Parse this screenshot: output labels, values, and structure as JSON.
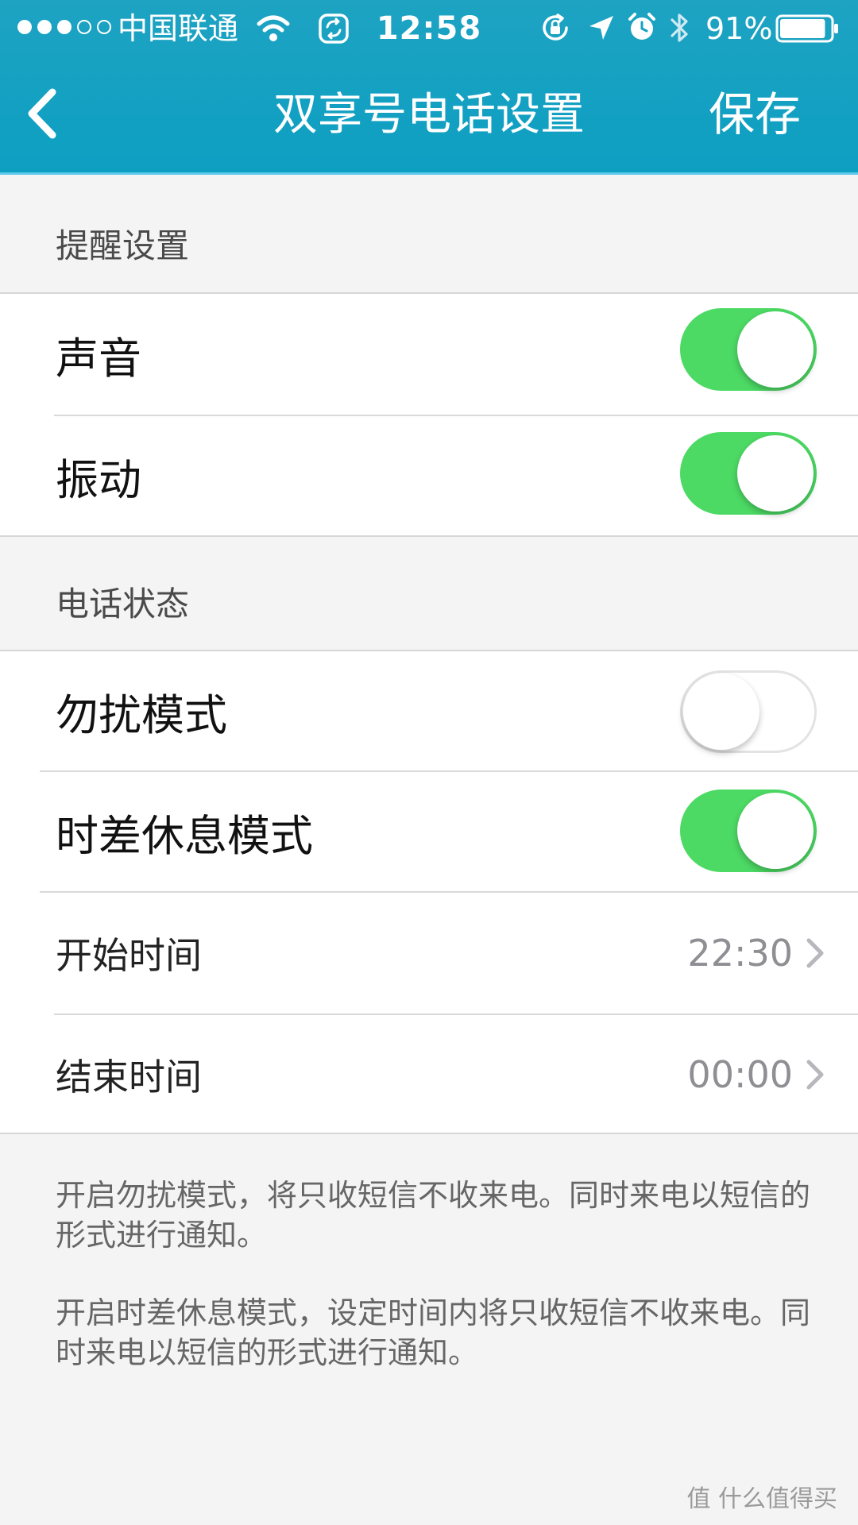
{
  "status_bar": {
    "carrier": "中国联通",
    "time": "12:58",
    "battery_percent": "91%",
    "battery_level": 0.91,
    "signal_bars_filled": 3,
    "signal_bars_total": 5,
    "icons": [
      "wifi-icon",
      "sync-icon",
      "rotation-lock-icon",
      "location-icon",
      "alarm-icon",
      "bluetooth-icon",
      "battery-icon"
    ]
  },
  "nav": {
    "title": "双享号电话设置",
    "back_icon": "chevron-left-icon",
    "save_label": "保存"
  },
  "theme": {
    "header_color": "#12a0c2",
    "toggle_on_color": "#4cd964",
    "background": "#f4f4f5"
  },
  "sections": [
    {
      "header": "提醒设置",
      "rows": [
        {
          "label": "声音",
          "toggle": true
        },
        {
          "label": "振动",
          "toggle": true
        }
      ]
    },
    {
      "header": "电话状态",
      "rows": [
        {
          "label": "勿扰模式",
          "toggle": false
        },
        {
          "label": "时差休息模式",
          "toggle": true
        },
        {
          "label": "开始时间",
          "value": "22:30"
        },
        {
          "label": "结束时间",
          "value": "00:00"
        }
      ]
    }
  ],
  "footnotes": [
    "开启勿扰模式，将只收短信不收来电。同时来电以短信的形式进行通知。",
    "开启时差休息模式，设定时间内将只收短信不收来电。同时来电以短信的形式进行通知。"
  ],
  "watermark": {
    "text": "值 什么值得买"
  }
}
